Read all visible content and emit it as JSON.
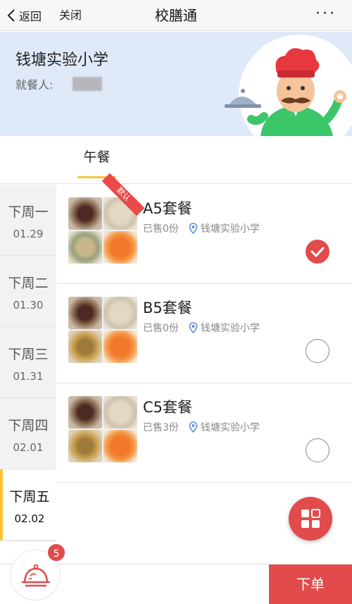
{
  "nav": {
    "back_label": "返回",
    "close_label": "关闭",
    "title": "校膳通",
    "more_label": "···"
  },
  "banner": {
    "school_name": "钱塘实验小学",
    "diner_label": "就餐人:"
  },
  "meal_tabs": [
    {
      "label": "午餐",
      "active": true
    }
  ],
  "days": [
    {
      "name": "下周一",
      "date": "01.29",
      "active": false
    },
    {
      "name": "下周二",
      "date": "01.30",
      "active": false
    },
    {
      "name": "下周三",
      "date": "01.31",
      "active": false
    },
    {
      "name": "下周四",
      "date": "02.01",
      "active": false
    },
    {
      "name": "下周五",
      "date": "02.02",
      "active": true
    }
  ],
  "meals": [
    {
      "title": "A5套餐",
      "sold": "已售0份",
      "location": "钱塘实验小学",
      "badge": "默认",
      "selected": true
    },
    {
      "title": "B5套餐",
      "sold": "已售0份",
      "location": "钱塘实验小学",
      "badge": "",
      "selected": false
    },
    {
      "title": "C5套餐",
      "sold": "已售3份",
      "location": "钱塘实验小学",
      "badge": "",
      "selected": false
    }
  ],
  "bottom": {
    "cart_count": "5",
    "order_label": "下单"
  },
  "colors": {
    "accent_red": "#e24b4b",
    "accent_yellow": "#f5c537",
    "banner_bg": "#dfe9f8",
    "location_icon": "#5b8fd9"
  },
  "icons": {
    "back": "chevron-left-icon",
    "more": "more-dots-icon",
    "location": "map-pin-icon",
    "check": "check-circle-icon",
    "grid": "grid-icon",
    "cart": "food-cloche-icon"
  }
}
